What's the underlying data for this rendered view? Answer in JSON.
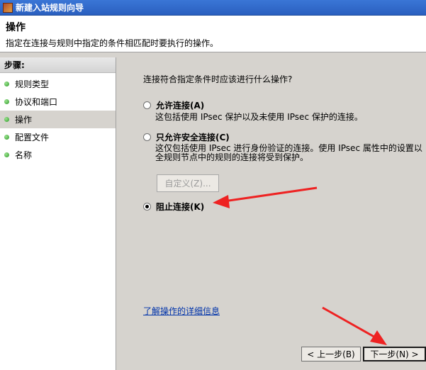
{
  "window": {
    "title": "新建入站规则向导"
  },
  "header": {
    "title": "操作",
    "description": "指定在连接与规则中指定的条件相匹配时要执行的操作。"
  },
  "sidebar": {
    "title": "步骤:",
    "items": [
      {
        "label": "规则类型",
        "active": false
      },
      {
        "label": "协议和端口",
        "active": false
      },
      {
        "label": "操作",
        "active": true
      },
      {
        "label": "配置文件",
        "active": false
      },
      {
        "label": "名称",
        "active": false
      }
    ]
  },
  "main": {
    "question": "连接符合指定条件时应该进行什么操作?",
    "options": [
      {
        "label": "允许连接(A)",
        "description": [
          "这包括使用 IPsec 保护以及未使用 IPsec 保护的连接。"
        ],
        "checked": false
      },
      {
        "label": "只允许安全连接(C)",
        "description": [
          "这仅包括使用 IPsec 进行身份验证的连接。使用 IPsec 属性中的设置以",
          "全规则节点中的规则的连接将受到保护。"
        ],
        "checked": false
      },
      {
        "label": "阻止连接(K)",
        "description": [],
        "checked": true
      }
    ],
    "customize_button": "自定义(Z)...",
    "learn_more_link": "了解操作的详细信息"
  },
  "footer": {
    "back_button": "< 上一步(B)",
    "next_button": "下一步(N) >"
  },
  "annotations": {
    "arrow_color": "#ee2222"
  }
}
